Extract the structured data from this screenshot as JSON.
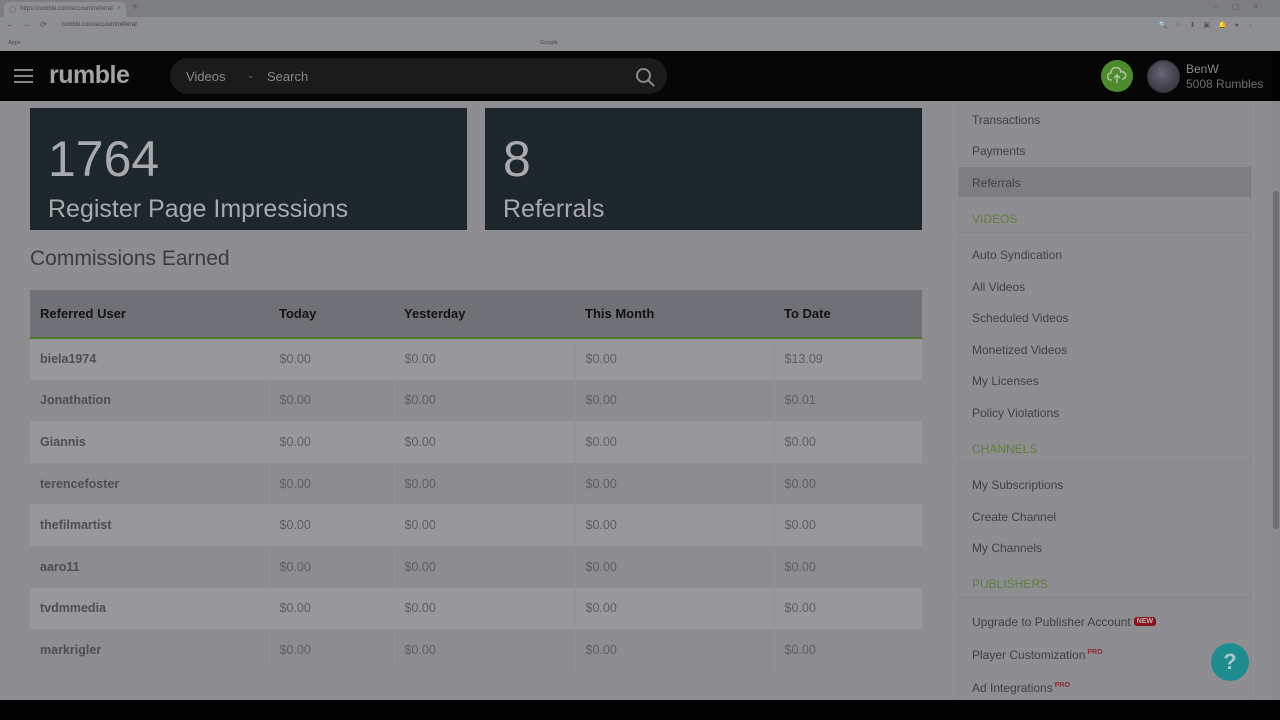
{
  "browser": {
    "tab_title": "https://rumble.com/account/referral",
    "new_tab": "+",
    "tab_close": "×",
    "window_controls": "–▢×",
    "nav_buttons": "←→⟳",
    "url": "rumble.com/account/referral",
    "extension_icons": "🔍☆⬇▣🔔●⋮",
    "bookmarks": [
      "Apps",
      "",
      "",
      "",
      "",
      "",
      "",
      "",
      "",
      "Google"
    ]
  },
  "header": {
    "logo": "rumble",
    "search_category": "Videos",
    "search_placeholder": "Search",
    "user_name": "BenW",
    "user_rumbles": "5008 Rumbles",
    "accent_color": "#4f8a2e"
  },
  "stats": [
    {
      "value": "1764",
      "label": "Register Page Impressions"
    },
    {
      "value": "8",
      "label": "Referrals"
    }
  ],
  "commissions": {
    "title": "Commissions Earned",
    "columns": [
      "Referred User",
      "Today",
      "Yesterday",
      "This Month",
      "To Date"
    ],
    "rows": [
      [
        "biela1974",
        "$0.00",
        "$0.00",
        "$0.00",
        "$13.09"
      ],
      [
        "Jonathation",
        "$0.00",
        "$0.00",
        "$0.00",
        "$0.01"
      ],
      [
        "Giannis",
        "$0.00",
        "$0.00",
        "$0.00",
        "$0.00"
      ],
      [
        "terencefoster",
        "$0.00",
        "$0.00",
        "$0.00",
        "$0.00"
      ],
      [
        "thefilmartist",
        "$0.00",
        "$0.00",
        "$0.00",
        "$0.00"
      ],
      [
        "aaro11",
        "$0.00",
        "$0.00",
        "$0.00",
        "$0.00"
      ],
      [
        "tvdmmedia",
        "$0.00",
        "$0.00",
        "$0.00",
        "$0.00"
      ],
      [
        "markrigler",
        "$0.00",
        "$0.00",
        "$0.00",
        "$0.00"
      ]
    ]
  },
  "sidebar": {
    "items_top": [
      {
        "label": "Transactions"
      },
      {
        "label": "Payments"
      },
      {
        "label": "Referrals",
        "active": true
      }
    ],
    "videos_heading": "VIDEOS",
    "videos_items": [
      {
        "label": "Auto Syndication"
      },
      {
        "label": "All Videos"
      },
      {
        "label": "Scheduled Videos"
      },
      {
        "label": "Monetized Videos"
      },
      {
        "label": "My Licenses"
      },
      {
        "label": "Policy Violations"
      }
    ],
    "channels_heading": "CHANNELS",
    "channels_items": [
      {
        "label": "My Subscriptions"
      },
      {
        "label": "Create Channel"
      },
      {
        "label": "My Channels"
      }
    ],
    "publishers_heading": "PUBLISHERS",
    "publishers_items": [
      {
        "label": "Upgrade to Publisher Account",
        "badge": "NEW"
      },
      {
        "label": "Player Customization",
        "badge": "PRO"
      },
      {
        "label": "Ad Integrations",
        "badge": "PRO"
      }
    ]
  },
  "help_button": "?"
}
